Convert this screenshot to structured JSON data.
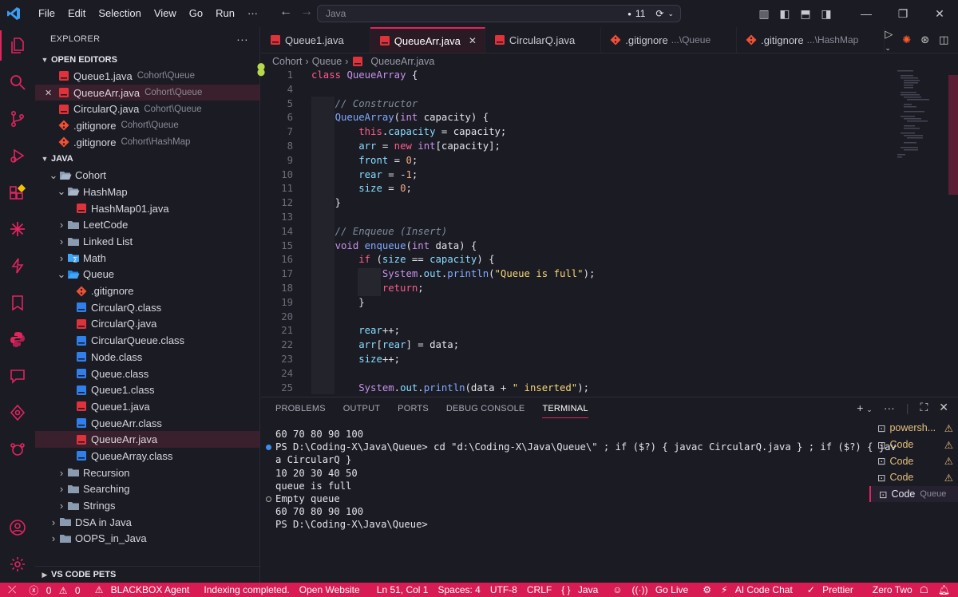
{
  "menu": [
    "File",
    "Edit",
    "Selection",
    "View",
    "Go",
    "Run",
    "···"
  ],
  "command_center": {
    "query": "Java",
    "badge": "11"
  },
  "explorer": {
    "title": "EXPLORER",
    "more": "···",
    "open_editors_label": "OPEN EDITORS",
    "open_editors": [
      {
        "name": "Queue1.java",
        "hint": "Cohort\\Queue",
        "icon": "java-file-icon",
        "close": ""
      },
      {
        "name": "QueueArr.java",
        "hint": "Cohort\\Queue",
        "icon": "java-file-icon",
        "close": "✕"
      },
      {
        "name": "CircularQ.java",
        "hint": "Cohort\\Queue",
        "icon": "java-file-icon",
        "close": ""
      },
      {
        "name": ".gitignore",
        "hint": "Cohort\\Queue",
        "icon": "git-icon",
        "close": ""
      },
      {
        "name": ".gitignore",
        "hint": "Cohort\\HashMap",
        "icon": "git-icon",
        "close": ""
      }
    ],
    "workspace_label": "JAVA",
    "tree": [
      {
        "name": "Cohort",
        "indent": 1,
        "type": "folder-open",
        "chev": "v"
      },
      {
        "name": "HashMap",
        "indent": 2,
        "type": "folder-open",
        "chev": "v"
      },
      {
        "name": "HashMap01.java",
        "indent": 3,
        "type": "java"
      },
      {
        "name": "LeetCode",
        "indent": 2,
        "type": "folder",
        "chev": ">"
      },
      {
        "name": "Linked List",
        "indent": 2,
        "type": "folder",
        "chev": ">"
      },
      {
        "name": "Math",
        "indent": 2,
        "type": "folder-math",
        "chev": ">"
      },
      {
        "name": "Queue",
        "indent": 2,
        "type": "folder-queue",
        "chev": "v"
      },
      {
        "name": ".gitignore",
        "indent": 3,
        "type": "git"
      },
      {
        "name": "CircularQ.class",
        "indent": 3,
        "type": "class"
      },
      {
        "name": "CircularQ.java",
        "indent": 3,
        "type": "java"
      },
      {
        "name": "CircularQueue.class",
        "indent": 3,
        "type": "class"
      },
      {
        "name": "Node.class",
        "indent": 3,
        "type": "class"
      },
      {
        "name": "Queue.class",
        "indent": 3,
        "type": "class"
      },
      {
        "name": "Queue1.class",
        "indent": 3,
        "type": "class"
      },
      {
        "name": "Queue1.java",
        "indent": 3,
        "type": "java"
      },
      {
        "name": "QueueArr.class",
        "indent": 3,
        "type": "class"
      },
      {
        "name": "QueueArr.java",
        "indent": 3,
        "type": "java",
        "selected": true
      },
      {
        "name": "QueueArray.class",
        "indent": 3,
        "type": "class"
      },
      {
        "name": "Recursion",
        "indent": 2,
        "type": "folder",
        "chev": ">"
      },
      {
        "name": "Searching",
        "indent": 2,
        "type": "folder",
        "chev": ">"
      },
      {
        "name": "Strings",
        "indent": 2,
        "type": "folder",
        "chev": ">"
      },
      {
        "name": "DSA in Java",
        "indent": 1,
        "type": "folder",
        "chev": ">"
      },
      {
        "name": "OOPS_in_Java",
        "indent": 1,
        "type": "folder",
        "chev": ">"
      }
    ],
    "pets_label": "VS CODE PETS"
  },
  "tabs": [
    {
      "name": "Queue1.java",
      "hint": "",
      "icon": "java",
      "active": false
    },
    {
      "name": "QueueArr.java",
      "hint": "",
      "icon": "java",
      "active": true
    },
    {
      "name": "CircularQ.java",
      "hint": "",
      "icon": "java",
      "active": false
    },
    {
      "name": ".gitignore",
      "hint": "...\\Queue",
      "icon": "git",
      "active": false
    },
    {
      "name": ".gitignore",
      "hint": "...\\HashMap",
      "icon": "git",
      "active": false
    }
  ],
  "breadcrumb": [
    "Cohort",
    "Queue",
    "QueueArr.java"
  ],
  "code_lines": [
    {
      "n": "1",
      "html": "<span class='k'>class</span> <span class='t'>QueueArray</span> {"
    },
    {
      "n": "4",
      "html": ""
    },
    {
      "n": "5",
      "html": "    <span class='c'>// Constructor</span>"
    },
    {
      "n": "6",
      "html": "    <span class='f'>QueueArray</span>(<span class='t'>int</span> capacity) {"
    },
    {
      "n": "7",
      "html": "        <span class='k'>this</span>.<span class='p'>capacity</span> = capacity;"
    },
    {
      "n": "8",
      "html": "        <span class='p'>arr</span> = <span class='k'>new</span> <span class='t'>int</span>[capacity];"
    },
    {
      "n": "9",
      "html": "        <span class='p'>front</span> = <span class='n'>0</span>;"
    },
    {
      "n": "10",
      "html": "        <span class='p'>rear</span> = -<span class='n'>1</span>;"
    },
    {
      "n": "11",
      "html": "        <span class='p'>size</span> = <span class='n'>0</span>;"
    },
    {
      "n": "12",
      "html": "    }"
    },
    {
      "n": "13",
      "html": ""
    },
    {
      "n": "14",
      "html": "    <span class='c'>// Enqueue (Insert)</span>"
    },
    {
      "n": "15",
      "html": "    <span class='t'>void</span> <span class='f'>enqueue</span>(<span class='t'>int</span> data) {"
    },
    {
      "n": "16",
      "html": "        <span class='k'>if</span> (<span class='p'>size</span> == <span class='p'>capacity</span>) {"
    },
    {
      "n": "17",
      "html": "            <span class='t'>System</span>.<span class='p'>out</span>.<span class='f'>println</span>(<span class='s'>\"Queue is full\"</span>);"
    },
    {
      "n": "18",
      "html": "            <span class='k'>return</span>;"
    },
    {
      "n": "19",
      "html": "        }"
    },
    {
      "n": "20",
      "html": ""
    },
    {
      "n": "21",
      "html": "        <span class='p'>rear</span>++;"
    },
    {
      "n": "22",
      "html": "        <span class='p'>arr</span>[<span class='p'>rear</span>] = data;"
    },
    {
      "n": "23",
      "html": "        <span class='p'>size</span>++;"
    },
    {
      "n": "24",
      "html": ""
    },
    {
      "n": "25",
      "html": "        <span class='t'>System</span>.<span class='p'>out</span>.<span class='f'>println</span>(data + <span class='s'>\" inserted\"</span>);"
    }
  ],
  "panel": {
    "tabs": [
      "PROBLEMS",
      "OUTPUT",
      "PORTS",
      "DEBUG CONSOLE",
      "TERMINAL"
    ],
    "active_tab": "TERMINAL",
    "terminal_lines": [
      {
        "text": "60 70 80 90 100",
        "dot": ""
      },
      {
        "text": "PS D:\\Coding-X\\Java\\Queue> cd \"d:\\Coding-X\\Java\\Queue\\\" ; if ($?) { javac CircularQ.java } ; if ($?) { jav",
        "dot": "blue"
      },
      {
        "text": "a CircularQ }",
        "dot": ""
      },
      {
        "text": "10 20 30 40 50",
        "dot": ""
      },
      {
        "text": "queue is full",
        "dot": ""
      },
      {
        "text": "Empty queue",
        "dot": "hollow"
      },
      {
        "text": "60 70 80 90 100",
        "dot": ""
      },
      {
        "text": "PS D:\\Coding-X\\Java\\Queue>",
        "dot": ""
      }
    ],
    "terminals": [
      {
        "name": "powersh...",
        "hint": "",
        "warn": "⚠",
        "active": false
      },
      {
        "name": "Code",
        "hint": "",
        "warn": "⚠",
        "active": false
      },
      {
        "name": "Code",
        "hint": "",
        "warn": "⚠",
        "active": false
      },
      {
        "name": "Code",
        "hint": "",
        "warn": "⚠",
        "active": false
      },
      {
        "name": "Code",
        "hint": "Queue",
        "warn": "",
        "active": true
      }
    ]
  },
  "status": {
    "errors": "0",
    "warnings": "0",
    "blackbox": "BLACKBOX Agent",
    "indexing": "Indexing completed.",
    "open_website": "Open Website",
    "cursor": "Ln 51, Col 1",
    "spaces": "Spaces: 4",
    "encoding": "UTF-8",
    "eol": "CRLF",
    "language": "Java",
    "golive": "Go Live",
    "aichat": "AI Code Chat",
    "prettier": "Prettier",
    "zerotwo": "Zero Two"
  },
  "colors": {
    "accent": "#e0245e",
    "status_bar": "#d81b52",
    "background": "#1b1b24"
  }
}
